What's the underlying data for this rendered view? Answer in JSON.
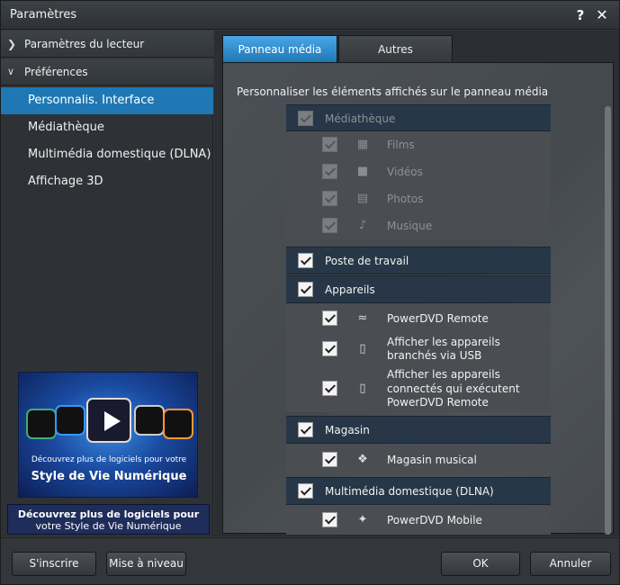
{
  "window": {
    "title": "Paramètres",
    "help": "?",
    "close": "✕"
  },
  "sidebar": {
    "groups": [
      {
        "label": "Paramètres du lecteur",
        "chevron": ">"
      },
      {
        "label": "Préférences",
        "chevron": "v"
      }
    ],
    "items": [
      {
        "label": "Personnalis. Interface",
        "active": true
      },
      {
        "label": "Médiathèque"
      },
      {
        "label": "Multimédia domestique (DLNA)"
      },
      {
        "label": "Affichage 3D"
      }
    ]
  },
  "ad": {
    "banner_line1": "Découvrez plus de logiciels pour votre",
    "banner_line2": "Style de Vie Numérique",
    "link_line1": "Découvrez plus de logiciels pour",
    "link_line2": "votre Style de Vie Numérique"
  },
  "tabs": [
    {
      "label": "Panneau média",
      "active": true
    },
    {
      "label": "Autres"
    }
  ],
  "content": {
    "title": "Personnaliser les éléments affichés sur le panneau média",
    "rows": [
      {
        "label": "Médiathèque",
        "kind": "cat",
        "checked": true,
        "disabled": true
      },
      {
        "label": "Films",
        "kind": "sub",
        "icon": "film-icon",
        "checked": true,
        "disabled": true
      },
      {
        "label": "Vidéos",
        "kind": "sub",
        "icon": "video-camera-icon",
        "checked": true,
        "disabled": true
      },
      {
        "label": "Photos",
        "kind": "sub",
        "icon": "photo-icon",
        "checked": true,
        "disabled": true
      },
      {
        "label": "Musique",
        "kind": "sub",
        "icon": "music-note-icon",
        "checked": true,
        "disabled": true
      },
      {
        "label": "Poste de travail",
        "kind": "cat",
        "checked": true
      },
      {
        "label": "Appareils",
        "kind": "cat",
        "checked": true
      },
      {
        "label": "PowerDVD Remote",
        "kind": "sub",
        "icon": "wifi-remote-icon",
        "checked": true
      },
      {
        "label": "Afficher les appareils branchés via USB",
        "kind": "sub",
        "icon": "phone-icon",
        "checked": true
      },
      {
        "label": "Afficher les appareils connectés qui exécutent PowerDVD Remote",
        "kind": "sub",
        "icon": "phone-icon",
        "checked": true
      },
      {
        "label": "Magasin",
        "kind": "cat",
        "checked": true
      },
      {
        "label": "Magasin musical",
        "kind": "sub",
        "icon": "music-store-icon",
        "checked": true
      },
      {
        "label": "Multimédia domestique (DLNA)",
        "kind": "cat",
        "checked": true
      },
      {
        "label": "PowerDVD Mobile",
        "kind": "sub",
        "icon": "satellite-icon",
        "checked": true
      }
    ]
  },
  "buttons": {
    "signup": "S'inscrire",
    "upgrade": "Mise à niveau",
    "ok": "OK",
    "cancel": "Annuler"
  }
}
